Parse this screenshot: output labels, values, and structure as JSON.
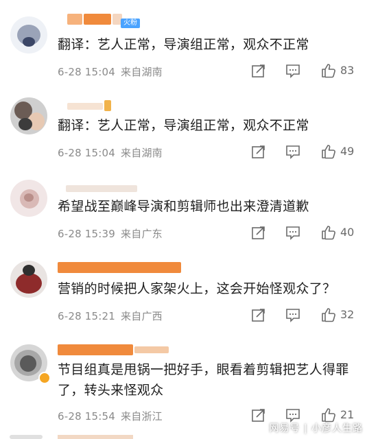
{
  "comments": [
    {
      "text": "翻译：艺人正常，导演组正常，观众不正常",
      "date": "6-28 15:04",
      "location": "来自湖南",
      "likes": "83",
      "badge": "火粉"
    },
    {
      "text": "翻译：艺人正常，导演组正常，观众不正常",
      "date": "6-28 15:04",
      "location": "来自湖南",
      "likes": "49",
      "badge": ""
    },
    {
      "text": "希望战至巅峰导演和剪辑师也出来澄清道歉",
      "date": "6-28 15:39",
      "location": "来自广东",
      "likes": "40",
      "badge": ""
    },
    {
      "text": "营销的时候把人家架火上，这会开始怪观众了？",
      "date": "6-28 15:21",
      "location": "来自广西",
      "likes": "32",
      "badge": ""
    },
    {
      "text": "节目组真是甩锅一把好手，眼看着剪辑把艺人得罪了，转头来怪观众",
      "date": "6-28 15:54",
      "location": "来自浙江",
      "likes": "21",
      "badge": ""
    }
  ],
  "icons": {
    "share": "share-icon",
    "comment": "comment-icon",
    "like": "thumbs-up-icon"
  },
  "watermark": "网易号 | 小彦人生路",
  "colors": {
    "text": "#1f1f1f",
    "meta": "#8a8a8a",
    "icon": "#6a6a6a",
    "name_bar": "#f08a3c",
    "badge": "#4aa3ff"
  }
}
